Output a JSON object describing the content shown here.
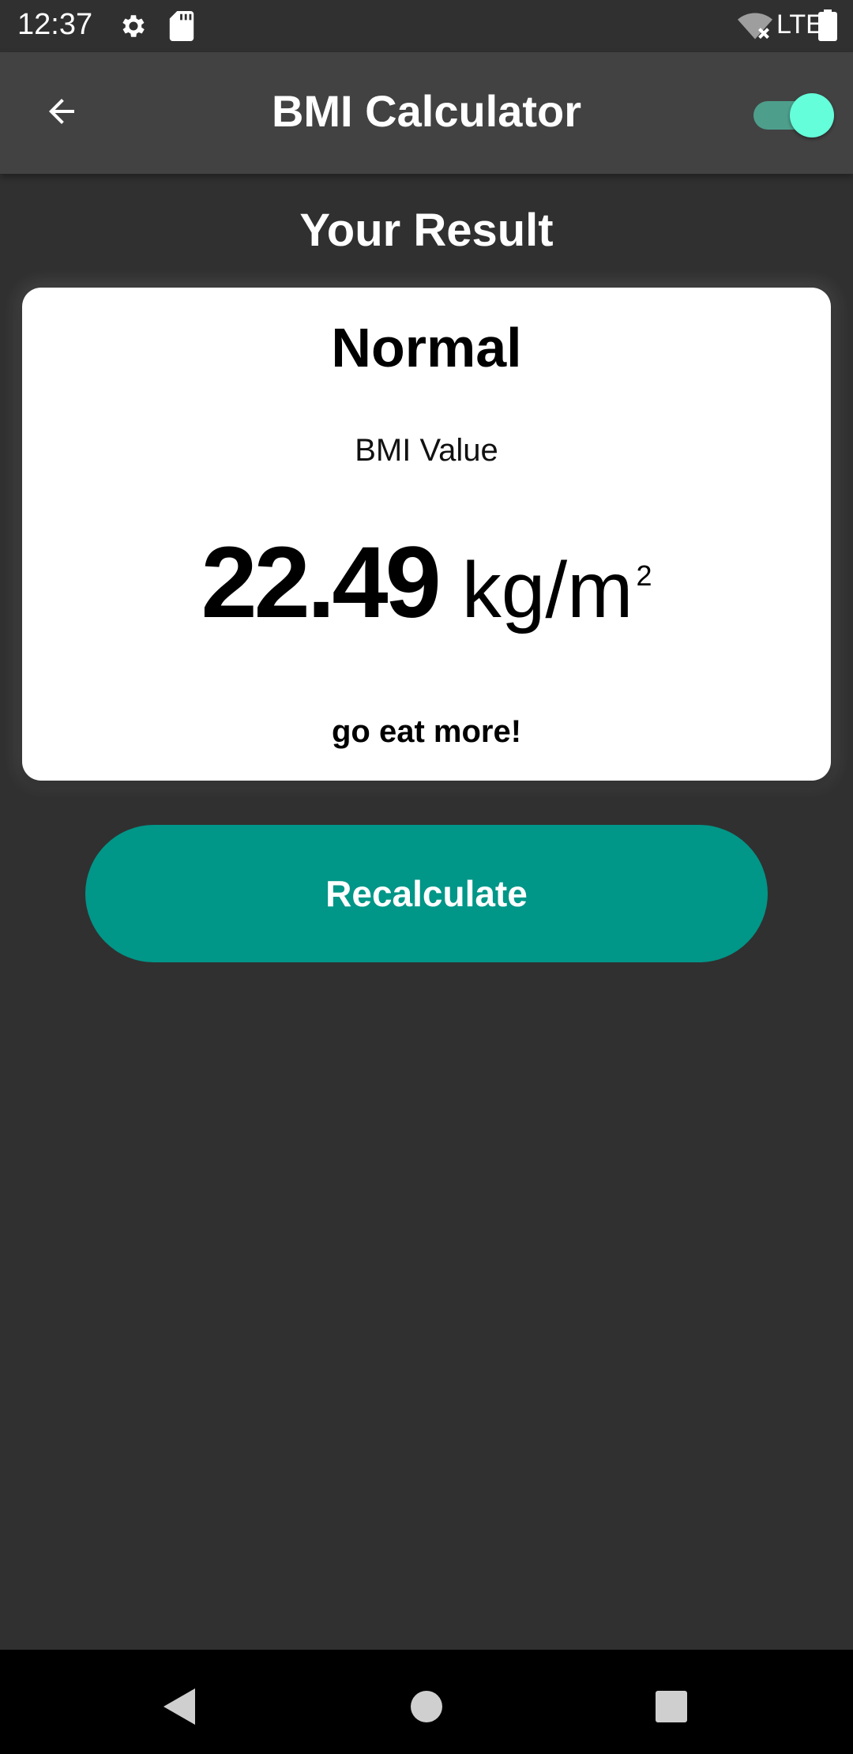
{
  "status_bar": {
    "time": "12:37",
    "network": "LTE",
    "icons": [
      "settings-icon",
      "sd-card-icon",
      "wifi-off-icon",
      "battery-icon"
    ]
  },
  "app_bar": {
    "title": "BMI Calculator",
    "back_icon": "arrow-back-icon",
    "theme_toggle_on": true
  },
  "heading": "Your Result",
  "result": {
    "category": "Normal",
    "caption": "BMI Value",
    "value": "22.49",
    "unit": "kg/m",
    "unit_exponent": "2",
    "advice": "go eat more!"
  },
  "recalculate_label": "Recalculate",
  "nav": [
    "back-nav-icon",
    "home-nav-icon",
    "recents-nav-icon"
  ],
  "colors": {
    "background": "#303030",
    "app_bar": "#424242",
    "accent": "#009688",
    "toggle_thumb": "#64ffda",
    "card": "#ffffff"
  }
}
